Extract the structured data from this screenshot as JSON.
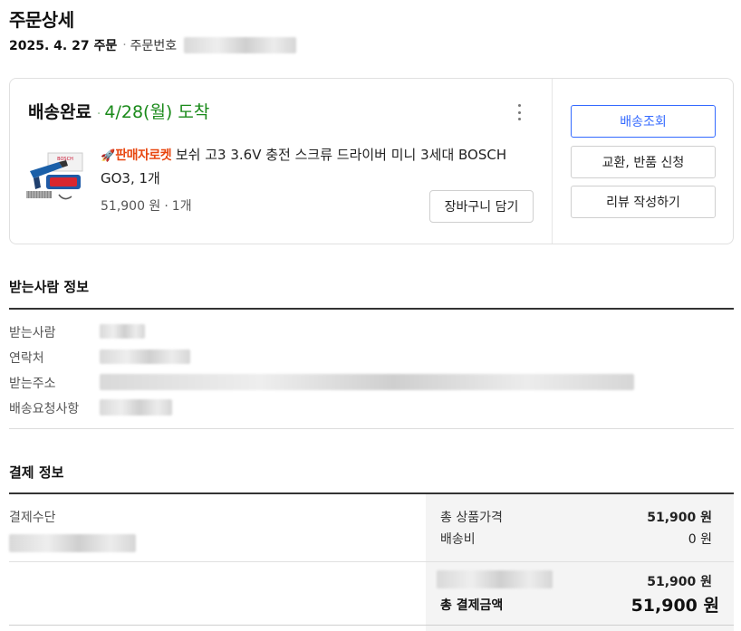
{
  "page": {
    "title": "주문상세"
  },
  "order": {
    "date": "2025. 4. 27 주문",
    "number_label": "주문번호"
  },
  "card": {
    "status": "배송완료",
    "separator": "·",
    "arrival": "4/28(월) 도착",
    "more_icon": "more-vertical-icon",
    "product": {
      "rocket_badge": "판매자로켓",
      "rocket_icon": "rocket-icon",
      "name": "보쉬 고3 3.6V 충전 스크류 드라이버 미니 3세대 BOSCH GO3, 1개",
      "price": "51,900 원",
      "quantity": "1개",
      "image_brand": "BOSCH"
    },
    "cart_button": "장바구니 담기",
    "actions": {
      "track": "배송조회",
      "exchange": "교환, 반품 신청",
      "review": "리뷰 작성하기"
    }
  },
  "recipient": {
    "title": "받는사람 정보",
    "fields": [
      {
        "label": "받는사람"
      },
      {
        "label": "연락처"
      },
      {
        "label": "받는주소"
      },
      {
        "label": "배송요청사항"
      }
    ]
  },
  "payment": {
    "title": "결제 정보",
    "method_label": "결제수단",
    "product_total_label": "총 상품가격",
    "product_total_value": "51,900 원",
    "shipping_label": "배송비",
    "shipping_value": "0 원",
    "method_amount": "51,900 원",
    "grand_total_label": "총 결제금액",
    "grand_total_value": "51,900 원"
  },
  "colors": {
    "accent_blue": "#346aff",
    "arrival_green": "#1a8a1a",
    "rocket_red": "#e8460f"
  }
}
